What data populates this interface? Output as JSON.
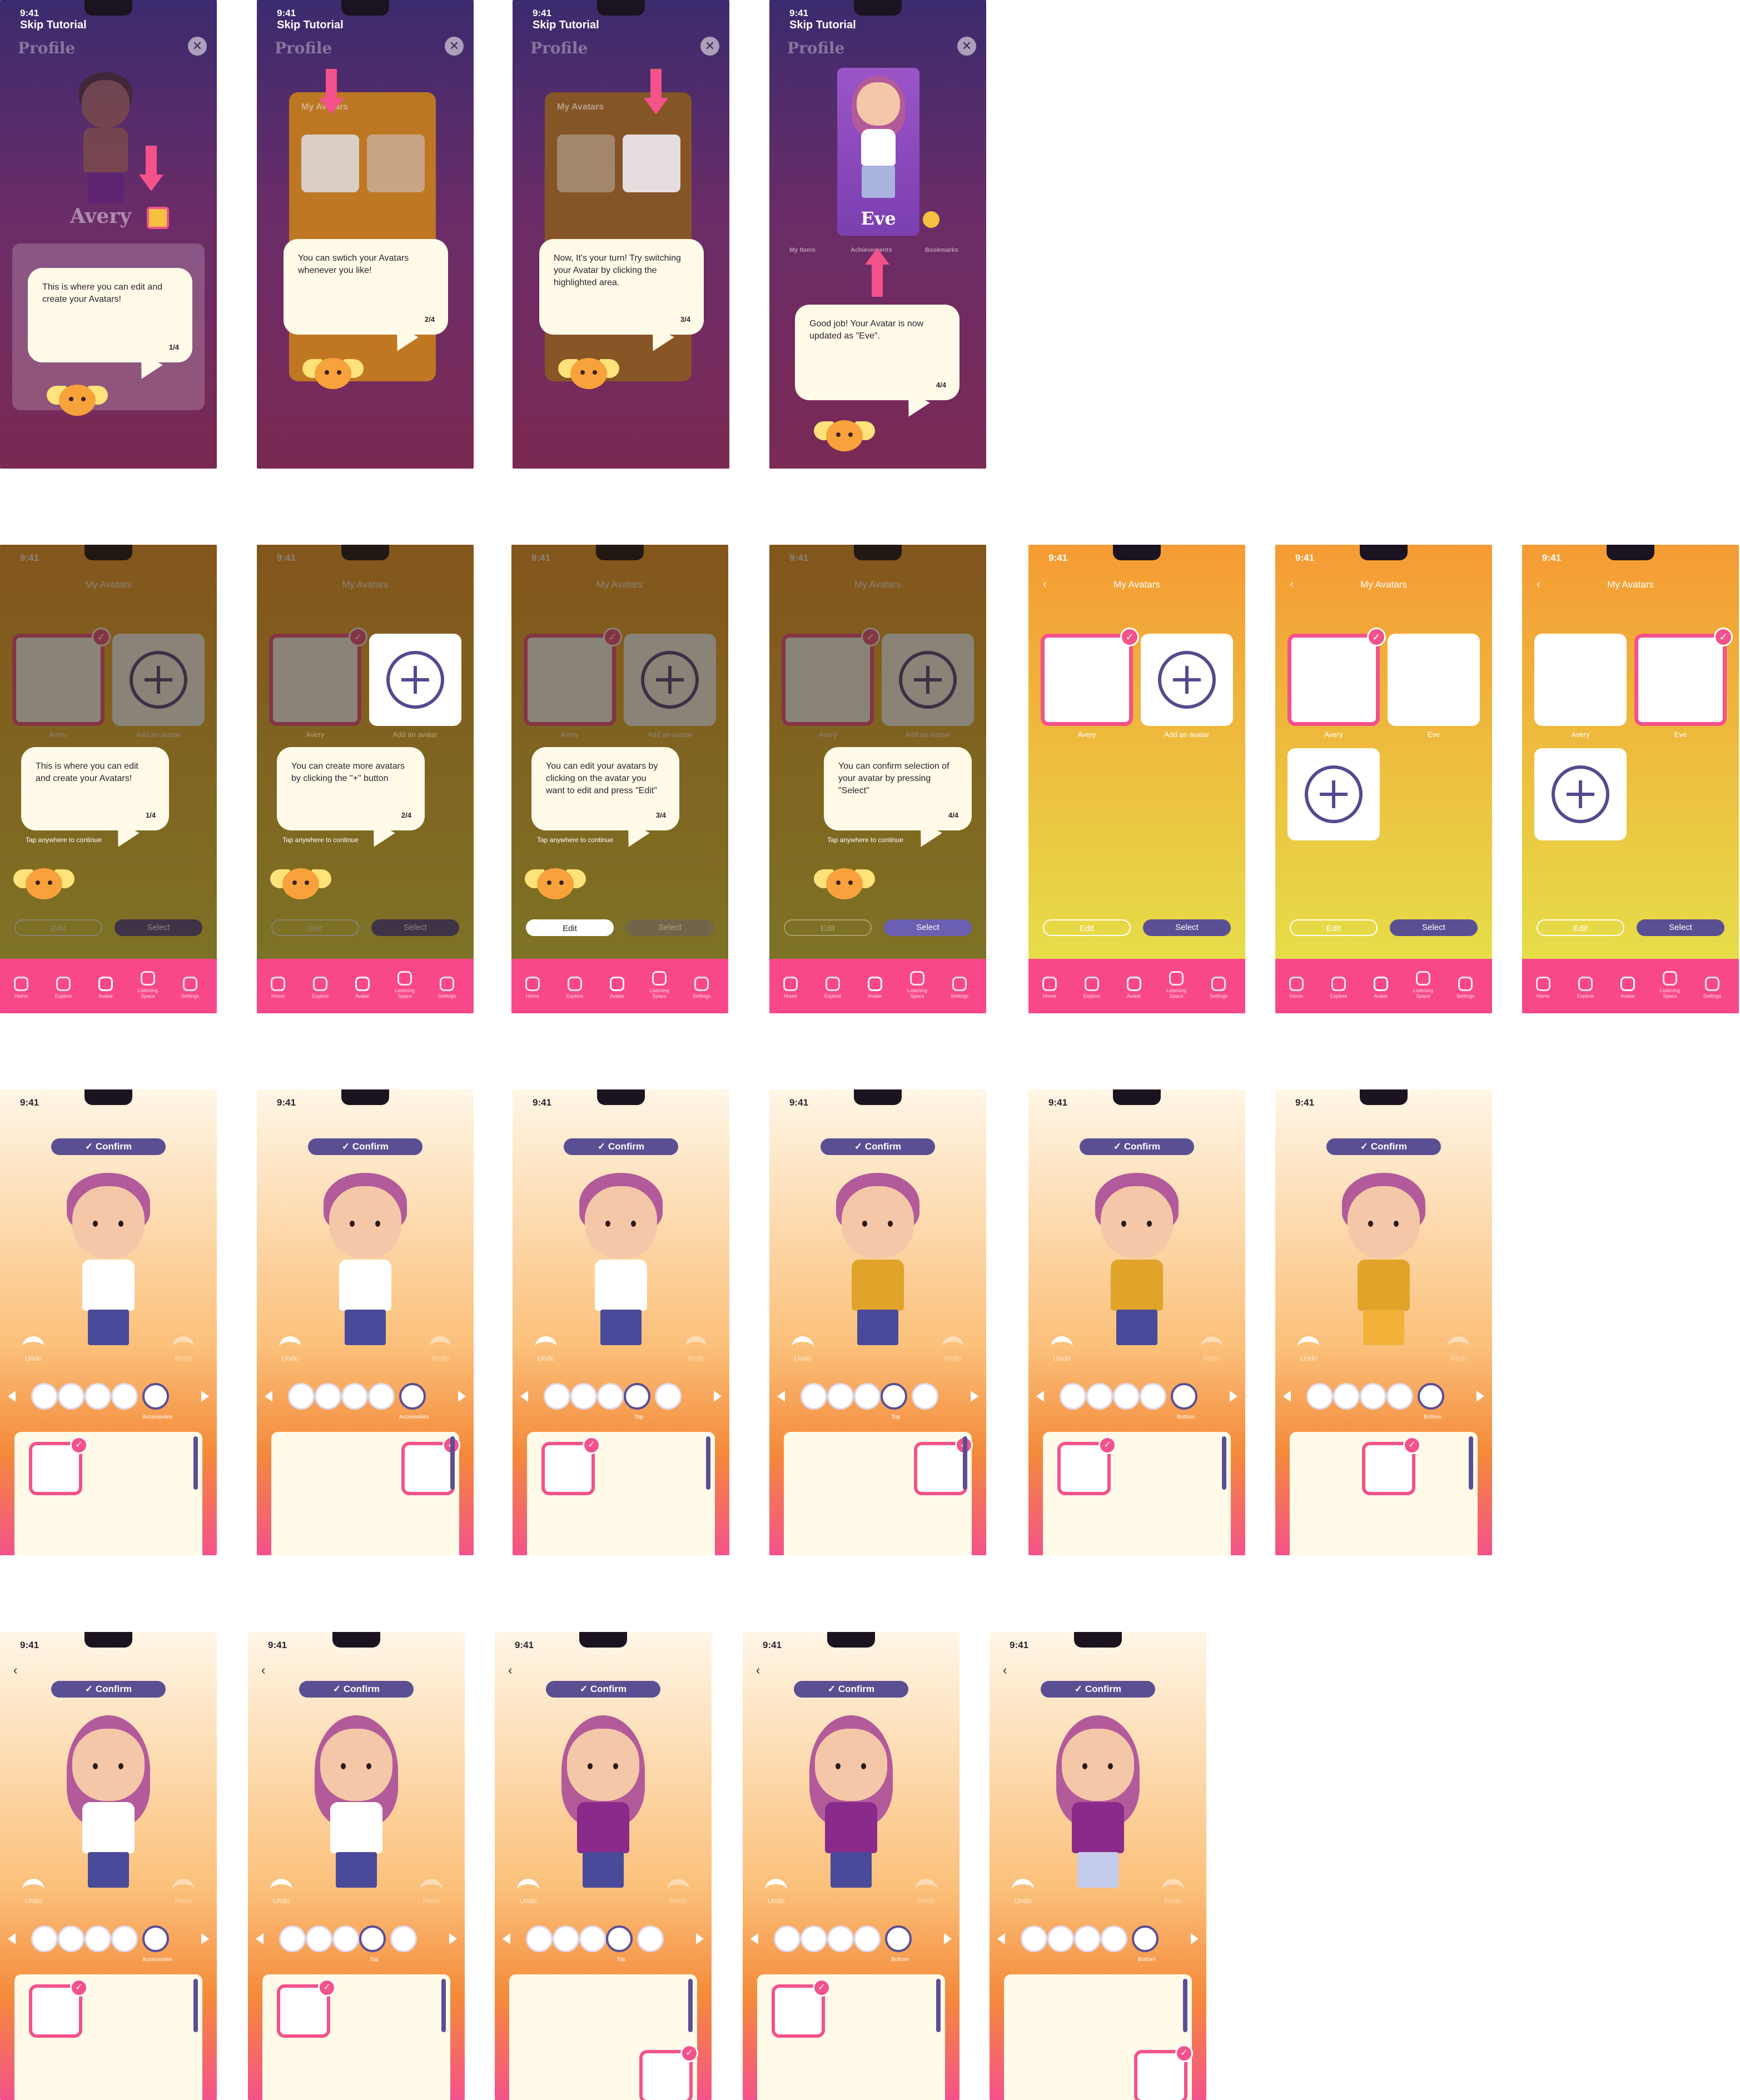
{
  "status": {
    "time": "9:41"
  },
  "row1": {
    "skip": "Skip Tutorial",
    "title": "Profile",
    "name_avery": "Avery",
    "name_eve": "Eve",
    "tabs_top": [
      "My Items",
      "Achievements",
      "Bookmarks"
    ],
    "dialog_title": "My Avatars",
    "bubbles": [
      {
        "text": "This is where you can edit and create your Avatars!",
        "step": "1/4"
      },
      {
        "text": "You can swtich your Avatars whenever you like!",
        "step": "2/4"
      },
      {
        "text": "Now, It's your turn! Try switching your Avatar by clicking the highlighted area.",
        "step": "3/4"
      },
      {
        "text": "Good job! Your Avatar is now updated as \"Eve\".",
        "step": "4/4"
      }
    ]
  },
  "row2": {
    "title": "My Avatars",
    "cap_avery": "Avery",
    "cap_add": "Add an avatar",
    "cap_eve": "Eve",
    "tap": "Tap anywhere to continue",
    "edit": "Edit",
    "select": "Select",
    "bubbles": [
      {
        "text": "This is where you can edit and create your Avatars!",
        "step": "1/4"
      },
      {
        "text": "You can create more avatars by clicking the \"+\" button",
        "step": "2/4"
      },
      {
        "text": "You can edit your avatars by clicking on the avatar you want to edit and press \"Edit\"",
        "step": "3/4"
      },
      {
        "text": "You can confirm selection of your avatar by pressing \"Select\"",
        "step": "4/4"
      }
    ],
    "tabs": [
      "Home",
      "Explore",
      "Avatar",
      "Listening Space",
      "Settings"
    ]
  },
  "editor": {
    "confirm": "Confirm",
    "undo": "Undo",
    "redo": "Redo",
    "cat_accessories": "Accessories",
    "cat_top": "Top",
    "cat_bottom": "Bottom"
  },
  "colors": {
    "accent_pink": "#f3528a",
    "tab_pink": "#f8488a",
    "purple": "#5b4f93",
    "cream": "#fffbe8"
  }
}
